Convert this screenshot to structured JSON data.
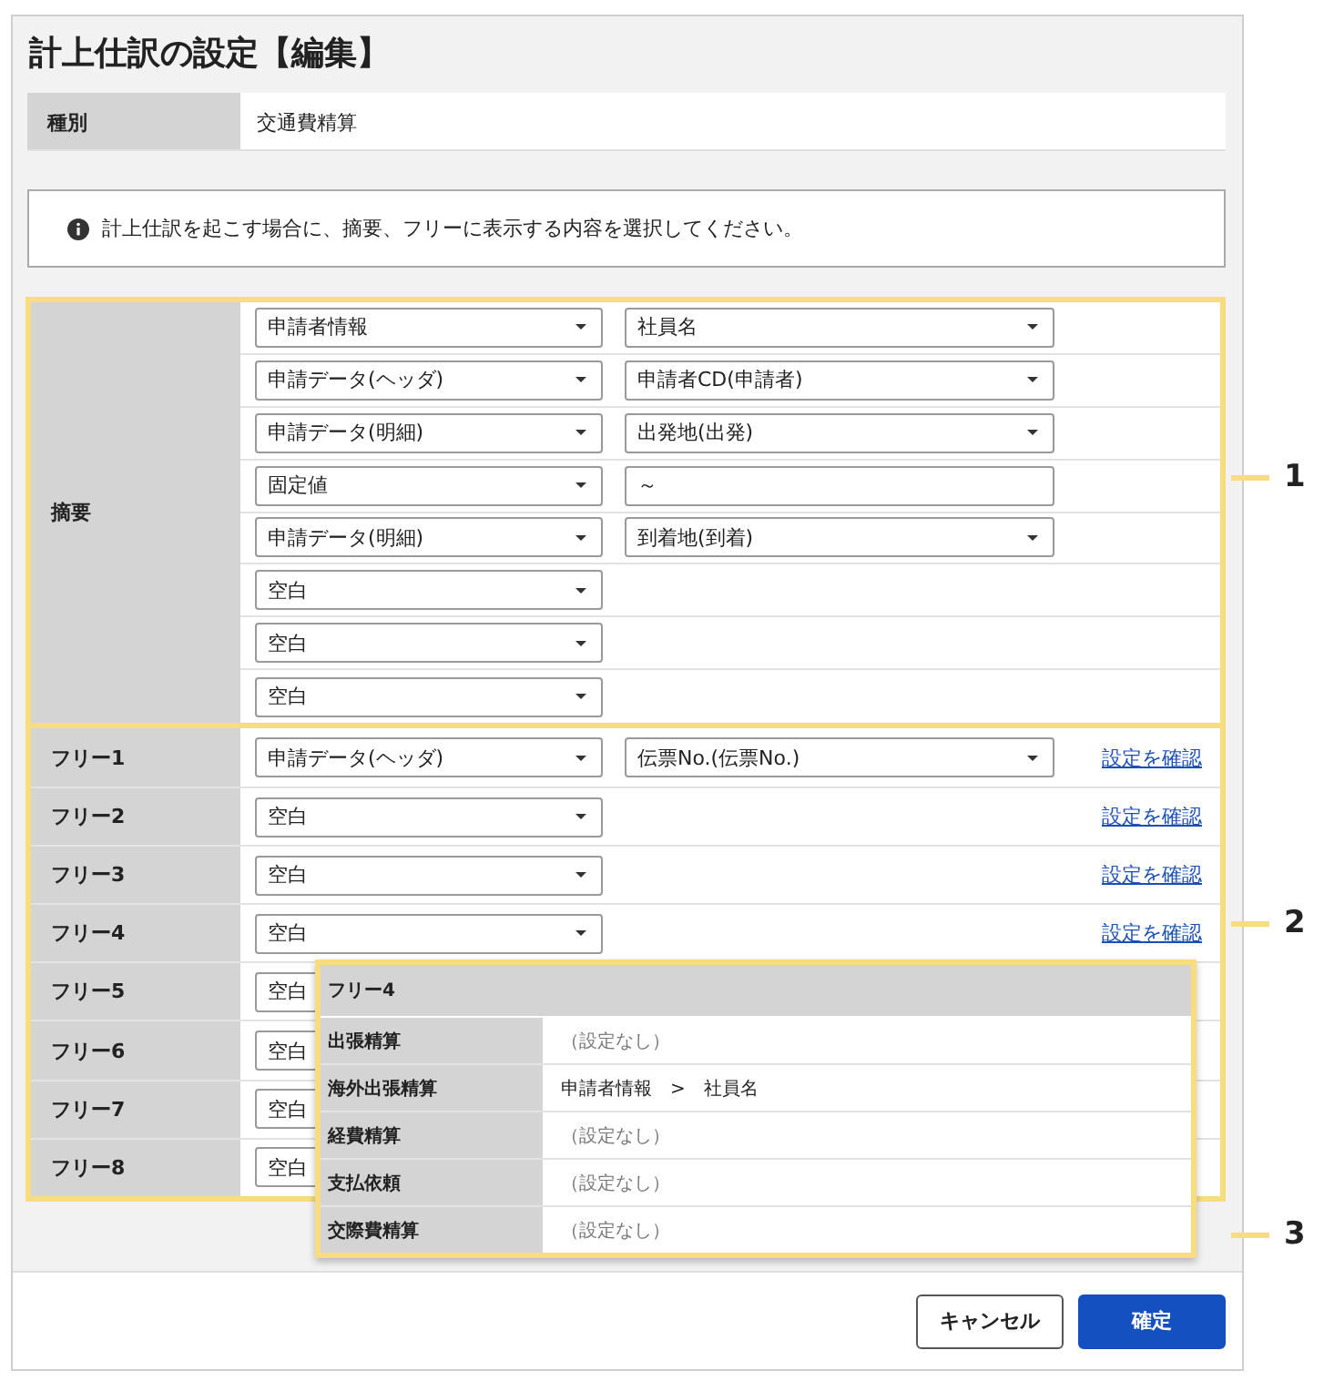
{
  "title": "計上仕訳の設定【編集】",
  "kind_row": {
    "label": "種別",
    "value": "交通費精算"
  },
  "info": {
    "text": "計上仕訳を起こす場合に、摘要、フリーに表示する内容を選択してください。"
  },
  "summary": {
    "label": "摘要",
    "rows": [
      {
        "fields": [
          {
            "kind": "select",
            "value": "申請者情報"
          },
          {
            "kind": "select",
            "value": "社員名"
          }
        ]
      },
      {
        "fields": [
          {
            "kind": "select",
            "value": "申請データ(ヘッダ)"
          },
          {
            "kind": "select",
            "value": "申請者CD(申請者)"
          }
        ]
      },
      {
        "fields": [
          {
            "kind": "select",
            "value": "申請データ(明細)"
          },
          {
            "kind": "select",
            "value": "出発地(出発)"
          }
        ]
      },
      {
        "fields": [
          {
            "kind": "select",
            "value": "固定値"
          },
          {
            "kind": "input",
            "value": "～"
          }
        ]
      },
      {
        "fields": [
          {
            "kind": "select",
            "value": "申請データ(明細)"
          },
          {
            "kind": "select",
            "value": "到着地(到着)"
          }
        ]
      },
      {
        "fields": [
          {
            "kind": "select",
            "value": "空白"
          }
        ]
      },
      {
        "fields": [
          {
            "kind": "select",
            "value": "空白"
          }
        ]
      },
      {
        "fields": [
          {
            "kind": "select",
            "value": "空白"
          }
        ]
      }
    ]
  },
  "free_rows": [
    {
      "label": "フリー1",
      "fields": [
        {
          "kind": "select",
          "value": "申請データ(ヘッダ)"
        },
        {
          "kind": "select",
          "value": "伝票No.(伝票No.)"
        }
      ],
      "link": "設定を確認"
    },
    {
      "label": "フリー2",
      "fields": [
        {
          "kind": "select",
          "value": "空白"
        }
      ],
      "link": "設定を確認"
    },
    {
      "label": "フリー3",
      "fields": [
        {
          "kind": "select",
          "value": "空白"
        }
      ],
      "link": "設定を確認"
    },
    {
      "label": "フリー4",
      "fields": [
        {
          "kind": "select",
          "value": "空白"
        }
      ],
      "link": "設定を確認"
    },
    {
      "label": "フリー5",
      "fields": [
        {
          "kind": "select",
          "value": "空白"
        }
      ]
    },
    {
      "label": "フリー6",
      "fields": [
        {
          "kind": "select",
          "value": "空白"
        }
      ]
    },
    {
      "label": "フリー7",
      "fields": [
        {
          "kind": "select",
          "value": "空白"
        }
      ]
    },
    {
      "label": "フリー8",
      "fields": [
        {
          "kind": "select",
          "value": "空白"
        }
      ]
    }
  ],
  "popup": {
    "title": "フリー4",
    "rows": [
      {
        "label": "出張精算",
        "value": "（設定なし）",
        "kind": "none"
      },
      {
        "label": "海外出張精算",
        "value": "申請者情報　>　社員名",
        "kind": "path"
      },
      {
        "label": "経費精算",
        "value": "（設定なし）",
        "kind": "none"
      },
      {
        "label": "支払依頼",
        "value": "（設定なし）",
        "kind": "none"
      },
      {
        "label": "交際費精算",
        "value": "（設定なし）",
        "kind": "none"
      }
    ]
  },
  "callouts": [
    "1",
    "2",
    "3"
  ],
  "buttons": [
    {
      "label": "キャンセル",
      "kind": "secondary"
    },
    {
      "label": "確定",
      "kind": "primary"
    }
  ]
}
